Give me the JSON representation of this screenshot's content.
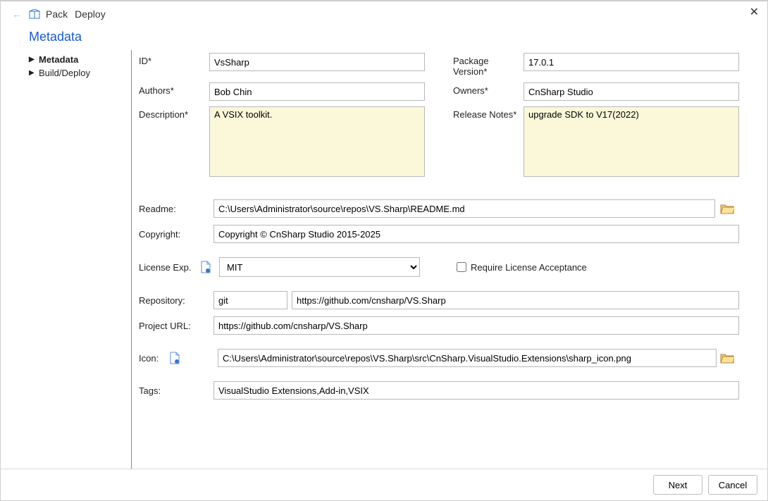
{
  "window": {
    "close_icon": "✕"
  },
  "toolbar": {
    "back_icon": "←",
    "pack_label": "Pack",
    "deploy_label": "Deploy"
  },
  "page_title": "Metadata",
  "sidebar": {
    "items": [
      {
        "label": "Metadata",
        "active": true
      },
      {
        "label": "Build/Deploy",
        "active": false
      }
    ]
  },
  "form": {
    "labels": {
      "id": "ID*",
      "package_version": "Package Version*",
      "authors": "Authors*",
      "owners": "Owners*",
      "description": "Description*",
      "release_notes": "Release Notes*",
      "readme": "Readme:",
      "copyright": "Copyright:",
      "license_exp": "License Exp.",
      "require_license": "Require License Acceptance",
      "repository": "Repository:",
      "project_url": "Project URL:",
      "icon": "Icon:",
      "tags": "Tags:"
    },
    "values": {
      "id": "VsSharp",
      "package_version": "17.0.1",
      "authors": "Bob Chin",
      "owners": "CnSharp Studio",
      "description": "A VSIX toolkit.",
      "release_notes": "upgrade SDK to V17(2022)",
      "readme": "C:\\Users\\Administrator\\source\\repos\\VS.Sharp\\README.md",
      "copyright": "Copyright © CnSharp Studio 2015-2025",
      "license_exp": "MIT",
      "require_license": false,
      "repository_type": "git",
      "repository_url": "https://github.com/cnsharp/VS.Sharp",
      "project_url": "https://github.com/cnsharp/VS.Sharp",
      "icon": "C:\\Users\\Administrator\\source\\repos\\VS.Sharp\\src\\CnSharp.VisualStudio.Extensions\\sharp_icon.png",
      "tags": "VisualStudio Extensions,Add-in,VSIX"
    }
  },
  "footer": {
    "next_label": "Next",
    "cancel_label": "Cancel"
  }
}
